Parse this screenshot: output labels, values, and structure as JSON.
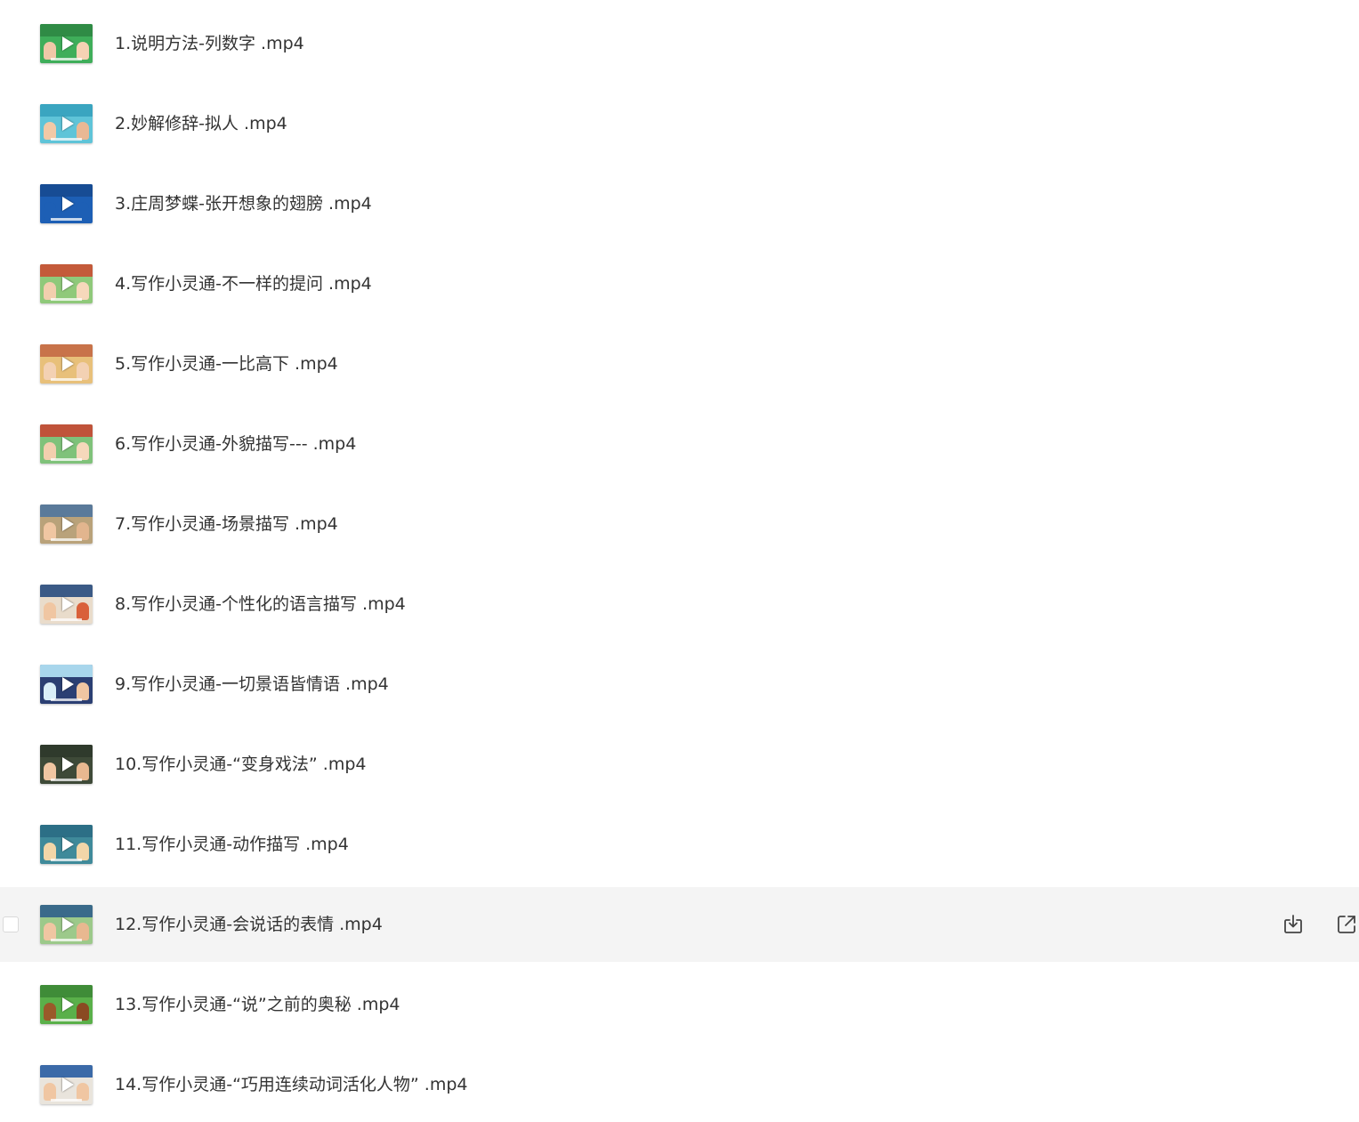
{
  "files": [
    {
      "name": "1.说明方法-列数字 .mp4",
      "thumb_icon": "video-thumbnail",
      "thumb_colors": {
        "bg": "#3fae5a",
        "band": "#2f8b45",
        "left": "#f0c8a8",
        "right": "#f6d2b4"
      }
    },
    {
      "name": "2.妙解修辞-拟人 .mp4",
      "thumb_icon": "video-thumbnail",
      "thumb_colors": {
        "bg": "#5fc4d8",
        "band": "#3aa5c0",
        "left": "#f2c9a6",
        "right": "#e9b894"
      }
    },
    {
      "name": "3.庄周梦蝶-张开想象的翅膀 .mp4",
      "thumb_icon": "video-thumbnail",
      "thumb_colors": {
        "bg": "#1d5fb5",
        "band": "#174c94",
        "left": "#1d5fb5",
        "right": "#1d5fb5"
      }
    },
    {
      "name": "4.写作小灵通-不一样的提问 .mp4",
      "thumb_icon": "video-thumbnail",
      "thumb_colors": {
        "bg": "#8fc97a",
        "band": "#c45a3a",
        "left": "#f2cfae",
        "right": "#f6d8bb"
      }
    },
    {
      "name": "5.写作小灵通-一比高下 .mp4",
      "thumb_icon": "video-thumbnail",
      "thumb_colors": {
        "bg": "#e8c07a",
        "band": "#c8734a",
        "left": "#f3d1b3",
        "right": "#f3d1b3"
      }
    },
    {
      "name": "6.写作小灵通-外貌描写--- .mp4",
      "thumb_icon": "video-thumbnail",
      "thumb_colors": {
        "bg": "#7fc27a",
        "band": "#c0533a",
        "left": "#f2cfae",
        "right": "#f6d8bb"
      }
    },
    {
      "name": "7.写作小灵通-场景描写 .mp4",
      "thumb_icon": "video-thumbnail",
      "thumb_colors": {
        "bg": "#b9a27a",
        "band": "#5a7a9a",
        "left": "#f0c6a2",
        "right": "#e2b58e"
      }
    },
    {
      "name": "8.写作小灵通-个性化的语言描写 .mp4",
      "thumb_icon": "video-thumbnail",
      "thumb_colors": {
        "bg": "#e9dccb",
        "band": "#3b5a86",
        "left": "#f0c6a2",
        "right": "#d9603a"
      }
    },
    {
      "name": "9.写作小灵通-一切景语皆情语 .mp4",
      "thumb_icon": "video-thumbnail",
      "thumb_colors": {
        "bg": "#2b3f73",
        "band": "#a8d6ec",
        "left": "#d9eef8",
        "right": "#f0c6a2"
      }
    },
    {
      "name": "10.写作小灵通-“变身戏法” .mp4",
      "thumb_icon": "video-thumbnail",
      "thumb_colors": {
        "bg": "#3e4a38",
        "band": "#2f3a2c",
        "left": "#f0c6a2",
        "right": "#e8b890"
      }
    },
    {
      "name": "11.写作小灵通-动作描写 .mp4",
      "thumb_icon": "video-thumbnail",
      "thumb_colors": {
        "bg": "#3f8a9a",
        "band": "#2c6f86",
        "left": "#f2d6a8",
        "right": "#f2d6a8"
      }
    },
    {
      "name": "12.写作小灵通-会说话的表情 .mp4",
      "thumb_icon": "video-thumbnail",
      "thumb_colors": {
        "bg": "#9cc98a",
        "band": "#3a6a8a",
        "left": "#f0c6a2",
        "right": "#e8b890"
      }
    },
    {
      "name": "13.写作小灵通-“说”之前的奥秘 .mp4",
      "thumb_icon": "video-thumbnail",
      "thumb_colors": {
        "bg": "#5ab04a",
        "band": "#3f8c38",
        "left": "#9a5a2a",
        "right": "#8a4a22"
      }
    },
    {
      "name": "14.写作小灵通-“巧用连续动词活化人物” .mp4",
      "thumb_icon": "video-thumbnail",
      "thumb_colors": {
        "bg": "#e9e4dc",
        "band": "#3b6aa8",
        "left": "#f0c6a2",
        "right": "#f0c6a2"
      }
    }
  ],
  "hovered_row_index": 11,
  "row_actions": {
    "download_icon": "download-icon",
    "share_icon": "open-external-icon"
  },
  "colors": {
    "text": "#333333",
    "hover_bg": "#f4f4f4",
    "icon": "#444444"
  }
}
